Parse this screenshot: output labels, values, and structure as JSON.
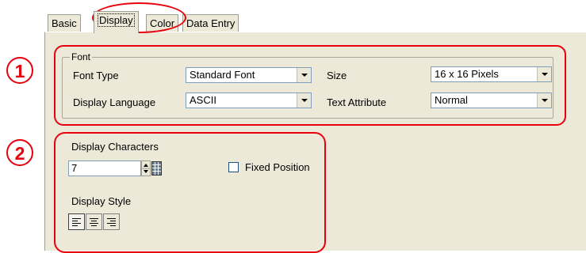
{
  "tabs": [
    {
      "label": "Basic"
    },
    {
      "label": "Display"
    },
    {
      "label": "Color"
    },
    {
      "label": "Data Entry"
    }
  ],
  "font_group": {
    "legend": "Font",
    "font_type_label": "Font Type",
    "font_type_value": "Standard Font",
    "size_label": "Size",
    "size_value": "16 x 16 Pixels",
    "display_language_label": "Display Language",
    "display_language_value": "ASCII",
    "text_attribute_label": "Text Attribute",
    "text_attribute_value": "Normal"
  },
  "display": {
    "characters_label": "Display Characters",
    "characters_value": "7",
    "fixed_position_label": "Fixed Position",
    "fixed_position_checked": false,
    "style_label": "Display Style",
    "style_options": [
      "align-left",
      "align-center",
      "align-right"
    ],
    "style_selected": "align-left"
  },
  "callouts": {
    "one": "1",
    "two": "2"
  },
  "colors": {
    "callout_red": "#e8000d",
    "panel": "#ece9d8"
  }
}
